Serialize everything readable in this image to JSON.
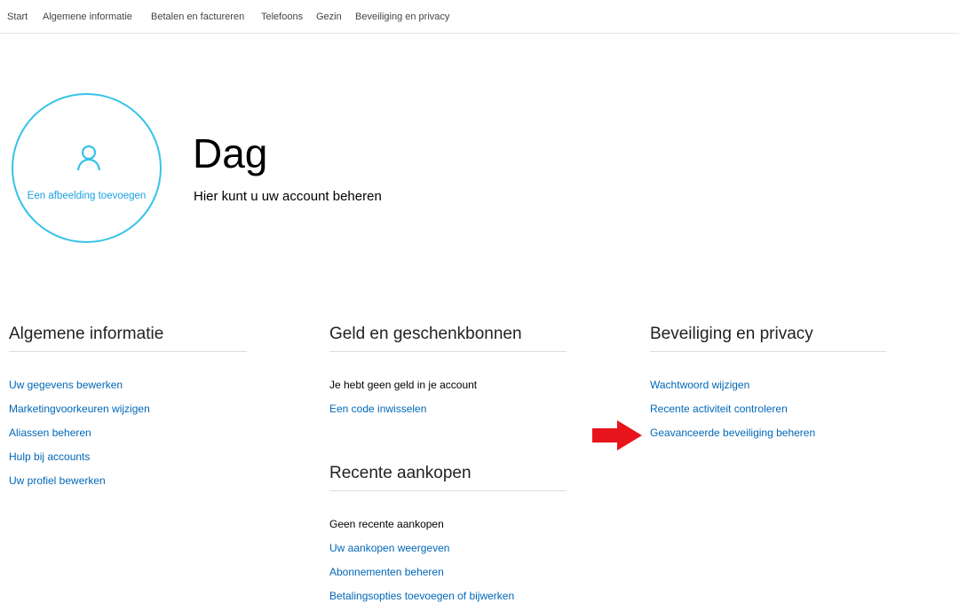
{
  "nav": {
    "items": [
      "Start",
      "Algemene informatie",
      "Betalen en factureren",
      "Telefoons",
      "Gezin",
      "Beveiliging en privacy"
    ]
  },
  "profile": {
    "add_picture_label": "Een afbeelding toevoegen",
    "greeting": "Dag",
    "subtitle": "Hier kunt u uw account beheren"
  },
  "general": {
    "title": "Algemene informatie",
    "links": [
      "Uw gegevens bewerken",
      "Marketingvoorkeuren wijzigen",
      "Aliassen beheren",
      "Hulp bij accounts",
      "Uw profiel bewerken"
    ]
  },
  "money": {
    "title": "Geld en geschenkbonnen",
    "status": "Je hebt geen geld in je account",
    "links": [
      "Een code inwisselen"
    ]
  },
  "purchases": {
    "title": "Recente aankopen",
    "status": "Geen recente aankopen",
    "links": [
      "Uw aankopen weergeven",
      "Abonnementen beheren",
      "Betalingsopties toevoegen of bijwerken"
    ]
  },
  "security": {
    "title": "Beveiliging en privacy",
    "links": [
      "Wachtwoord wijzigen",
      "Recente activiteit controleren",
      "Geavanceerde beveiliging beheren"
    ]
  },
  "colors": {
    "accent_circle": "#36c3e8",
    "link": "#0067b8",
    "arrow": "#e8141c"
  },
  "icons": {
    "avatar": "person-icon",
    "pointer": "red-arrow-icon"
  }
}
